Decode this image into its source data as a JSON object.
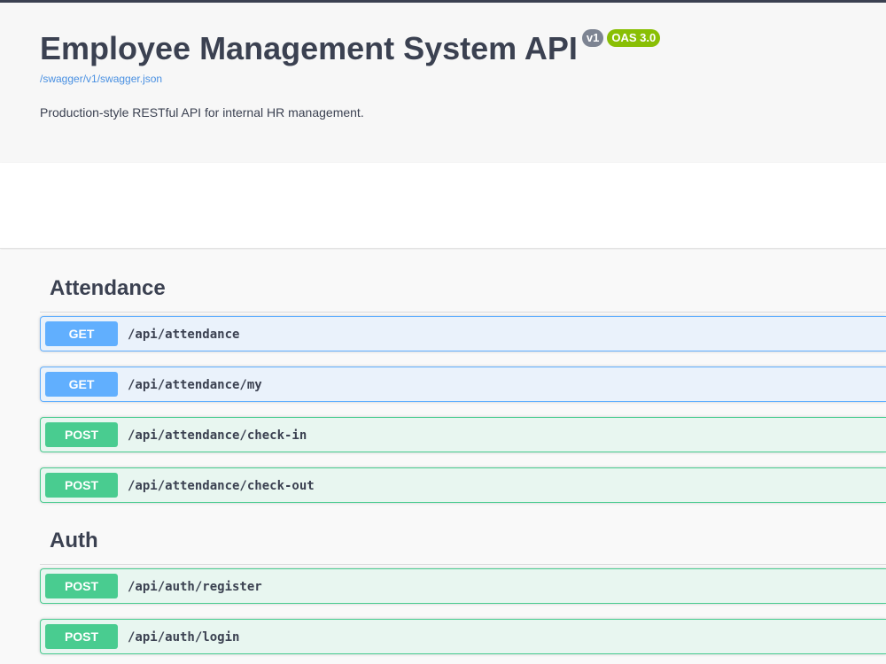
{
  "info": {
    "title": "Employee Management System API",
    "version_badge": "v1",
    "oas_badge": "OAS 3.0",
    "spec_link": "/swagger/v1/swagger.json",
    "description": "Production-style RESTful API for internal HR management."
  },
  "tags": [
    {
      "name": "Attendance",
      "operations": [
        {
          "method": "GET",
          "path": "/api/attendance"
        },
        {
          "method": "GET",
          "path": "/api/attendance/my"
        },
        {
          "method": "POST",
          "path": "/api/attendance/check-in"
        },
        {
          "method": "POST",
          "path": "/api/attendance/check-out"
        }
      ]
    },
    {
      "name": "Auth",
      "operations": [
        {
          "method": "POST",
          "path": "/api/auth/register"
        },
        {
          "method": "POST",
          "path": "/api/auth/login"
        }
      ]
    }
  ],
  "colors": {
    "get": "#61affe",
    "post": "#49cc90",
    "oas_badge": "#89bf04",
    "version_badge": "#7d8492",
    "link": "#4990e2"
  }
}
